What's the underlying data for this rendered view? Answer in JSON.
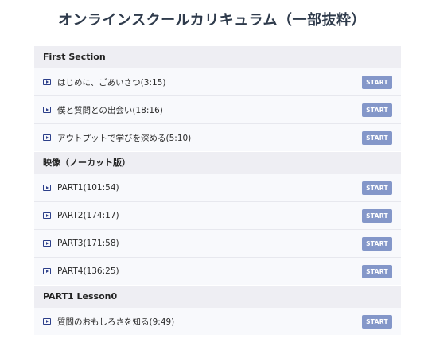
{
  "page": {
    "title": "オンラインスクールカリキュラム（一部抜粋）"
  },
  "colors": {
    "title": "#2f3b4c",
    "section_header_bg": "#eeeef3",
    "row_bg": "#f8f9fc",
    "start_button": "#8497c9",
    "play_icon": "#2c3f8a"
  },
  "sections": [
    {
      "title": "First Section",
      "lectures": [
        {
          "title": "はじめに、ごあいさつ(3:15)",
          "button": "START",
          "icon": "play-icon"
        },
        {
          "title": "僕と質問との出会い(18:16)",
          "button": "START",
          "icon": "play-icon"
        },
        {
          "title": "アウトプットで学びを深める(5:10)",
          "button": "START",
          "icon": "play-icon"
        }
      ]
    },
    {
      "title": "映像（ノーカット版）",
      "lectures": [
        {
          "title": "PART1(101:54)",
          "button": "START",
          "icon": "play-icon"
        },
        {
          "title": "PART2(174:17)",
          "button": "START",
          "icon": "play-icon"
        },
        {
          "title": "PART3(171:58)",
          "button": "START",
          "icon": "play-icon"
        },
        {
          "title": "PART4(136:25)",
          "button": "START",
          "icon": "play-icon"
        }
      ]
    },
    {
      "title": "PART1 Lesson0",
      "lectures": [
        {
          "title": "質問のおもしろさを知る(9:49)",
          "button": "START",
          "icon": "play-icon"
        }
      ]
    }
  ]
}
